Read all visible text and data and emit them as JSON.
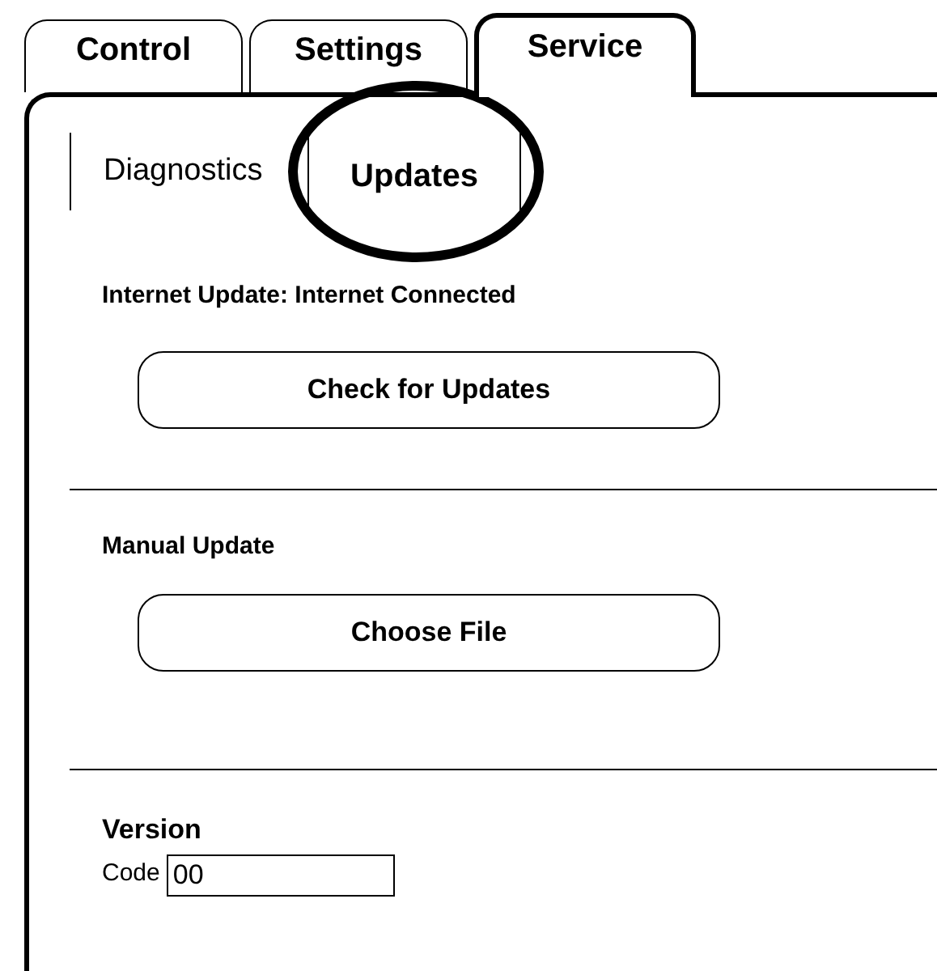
{
  "tabs": [
    {
      "label": "Control",
      "selected": false
    },
    {
      "label": "Settings",
      "selected": false
    },
    {
      "label": "Service",
      "selected": true
    }
  ],
  "subtabs": [
    {
      "label": "Diagnostics",
      "selected": false,
      "circled": false
    },
    {
      "label": "Updates",
      "selected": true,
      "circled": true
    }
  ],
  "sections": [
    {
      "kind": "button",
      "title": "Internet Update: Internet Connected",
      "button": "Check for Updates"
    },
    {
      "kind": "button",
      "title": "Manual Update",
      "button": "Choose File"
    },
    {
      "kind": "field",
      "title": "Version",
      "label": "Code",
      "value": "00"
    }
  ]
}
